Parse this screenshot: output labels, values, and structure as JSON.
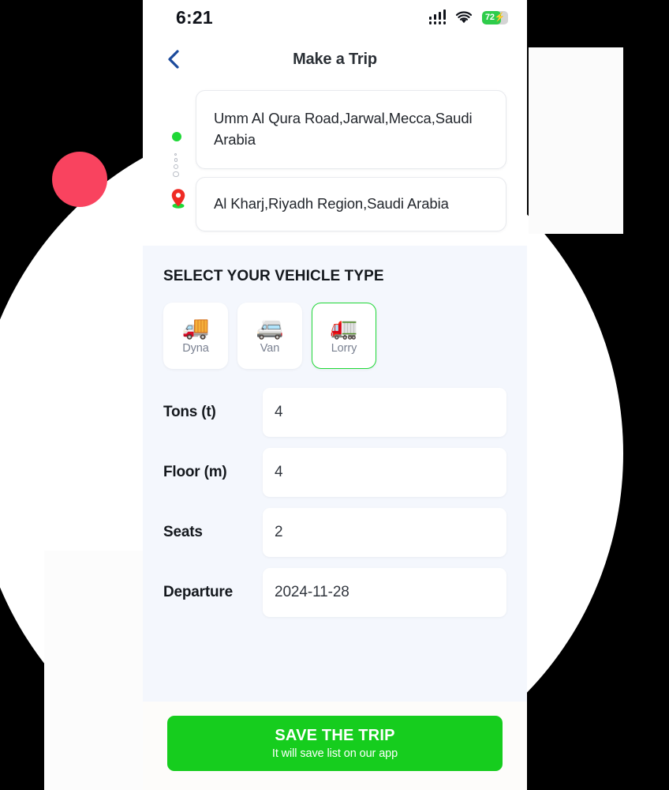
{
  "status_bar": {
    "time": "6:21",
    "signal_icon": "cellular-signal-icon",
    "wifi_icon": "wifi-icon",
    "battery_level": "72",
    "battery_charging_icon": "lightning-bolt-icon"
  },
  "header": {
    "back_icon": "chevron-left-icon",
    "title": "Make a Trip"
  },
  "route": {
    "origin_icon": "green-dot-icon",
    "connector_icon": "dotted-route-icon",
    "destination_icon": "map-pin-icon",
    "origin_address": "Umm Al Qura Road,Jarwal,Mecca,Saudi Arabia",
    "destination_address": "Al Kharj,Riyadh Region,Saudi Arabia"
  },
  "vehicle_section": {
    "title": "SELECT YOUR VEHICLE TYPE",
    "options": [
      {
        "label": "Dyna",
        "icon": "delivery-truck-icon",
        "glyph": "🚚",
        "selected": false
      },
      {
        "label": "Van",
        "icon": "minibus-icon",
        "glyph": "🚐",
        "selected": false
      },
      {
        "label": "Lorry",
        "icon": "truck-icon",
        "glyph": "🚛",
        "selected": true
      }
    ],
    "selected_value": "Lorry",
    "selected_color": "#1fd837"
  },
  "fields": [
    {
      "label": "Tons (t)",
      "value": "4"
    },
    {
      "label": "Floor (m)",
      "value": "4"
    },
    {
      "label": "Seats",
      "value": "2"
    },
    {
      "label": "Departure",
      "value": "2024-11-28"
    }
  ],
  "footer": {
    "save_title": "SAVE THE TRIP",
    "save_subtitle": "It will save list on our app",
    "save_color": "#16cd1e"
  },
  "decorations": {
    "backdrop_color": "#000000",
    "ellipse_color": "#ffffff",
    "accent_circle_color": "#f9435f"
  }
}
